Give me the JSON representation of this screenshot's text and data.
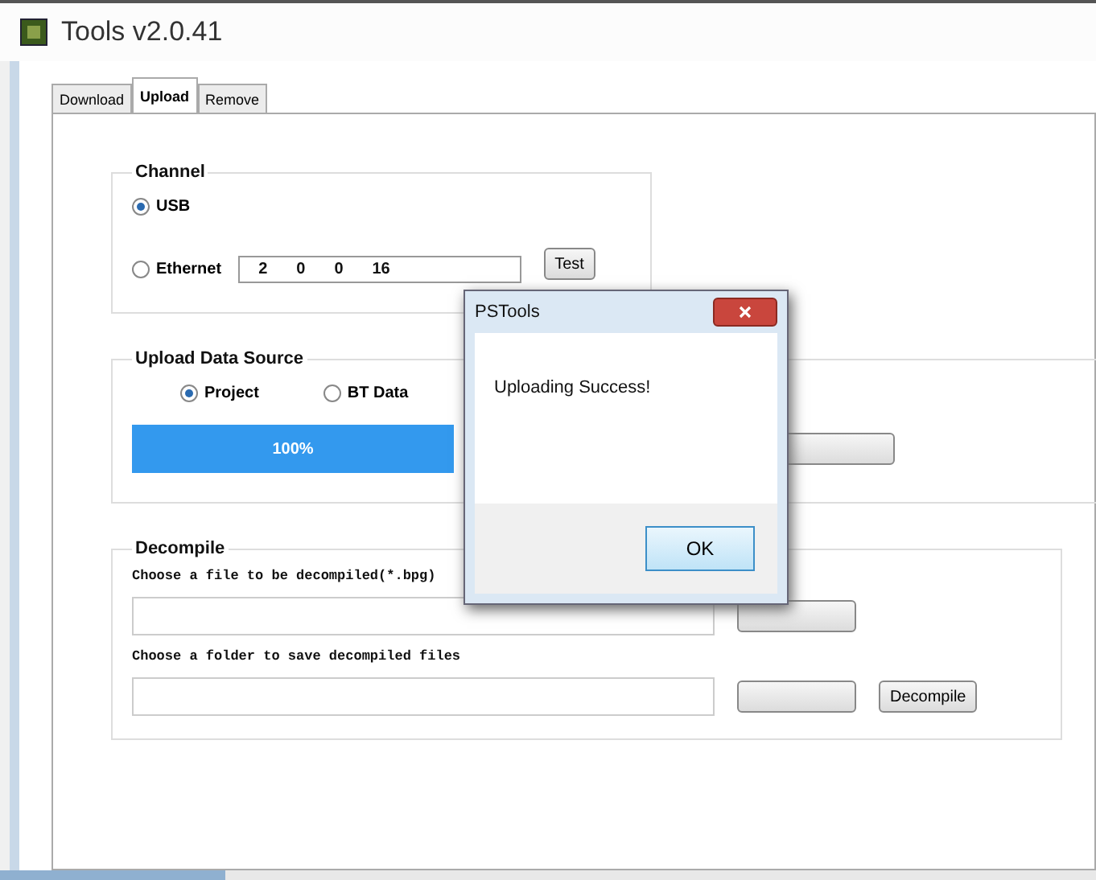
{
  "window": {
    "title": "Tools v2.0.41"
  },
  "tabs": [
    {
      "label": "Download",
      "selected": false
    },
    {
      "label": "Upload",
      "selected": true
    },
    {
      "label": "Remove",
      "selected": false
    }
  ],
  "channel": {
    "title": "Channel",
    "options": [
      {
        "label": "USB",
        "selected": true
      },
      {
        "label": "Ethernet",
        "selected": false
      }
    ],
    "ip": [
      "2",
      "0",
      "0",
      "16"
    ],
    "button": "Test"
  },
  "upload_source": {
    "title": "Upload Data Source",
    "options": [
      {
        "label": "Project",
        "selected": true
      },
      {
        "label": "BT Data",
        "selected": false
      }
    ],
    "progress": {
      "level": 1,
      "text": "100%"
    }
  },
  "decompile": {
    "title": "Decompile",
    "file_label": "Choose a file to be decompiled(*.bpg)",
    "folder_label": "Choose a folder to save decompiled files",
    "button": "Decompile"
  },
  "dialog": {
    "title": "PSTools",
    "message": "Uploading Success!",
    "button": "OK"
  }
}
